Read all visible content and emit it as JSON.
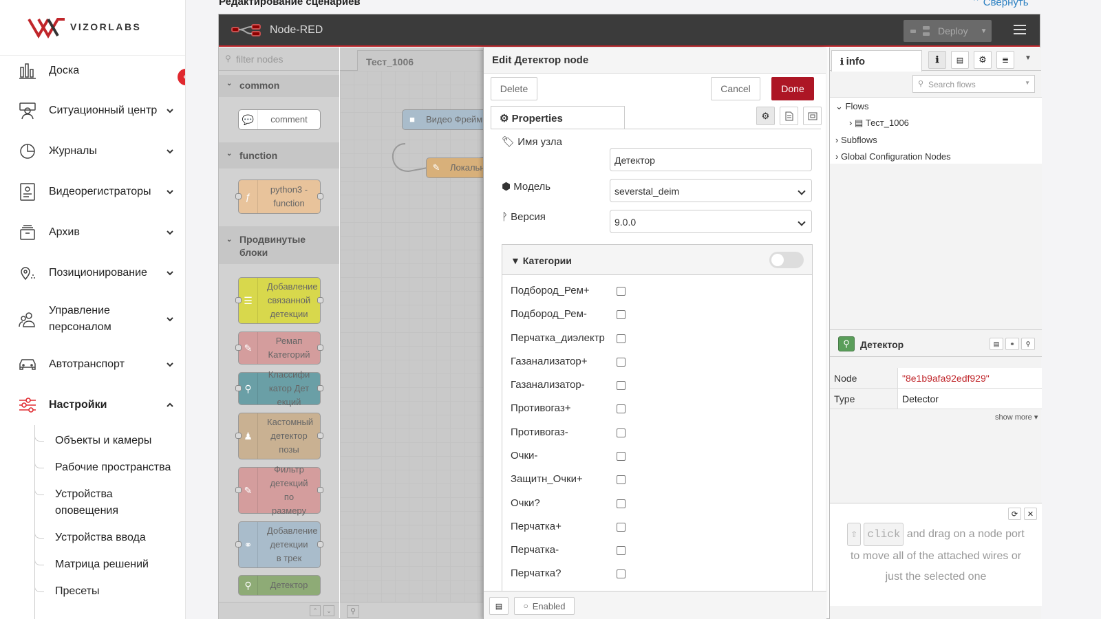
{
  "brand": {
    "name": "VIZORLABS"
  },
  "sidebar": {
    "items": [
      {
        "label": "Доска",
        "icon": "dashboard-icon"
      },
      {
        "label": "Ситуационный центр",
        "icon": "situation-center-icon"
      },
      {
        "label": "Журналы",
        "icon": "journal-chart-icon"
      },
      {
        "label": "Видеорегистраторы",
        "icon": "video-recorder-icon"
      },
      {
        "label": "Архив",
        "icon": "archive-icon"
      },
      {
        "label": "Позиционирование",
        "icon": "location-icon"
      },
      {
        "label": "Управление персоналом",
        "icon": "staff-icon"
      },
      {
        "label": "Автотранспорт",
        "icon": "car-icon"
      },
      {
        "label": "Настройки",
        "icon": "settings-sliders-icon"
      }
    ],
    "sub_items": [
      "Объекты и камеры",
      "Рабочие пространства",
      "Устройства оповещения",
      "Устройства ввода",
      "Матрица решений",
      "Пресеты"
    ],
    "accent": "#e0282e"
  },
  "page": {
    "title": "Редактирование сценариев",
    "collapse_label": "Свернуть"
  },
  "nodered": {
    "title": "Node-RED",
    "deploy_label": "Deploy",
    "palette": {
      "filter_placeholder": "filter nodes",
      "categories": [
        {
          "name": "common",
          "nodes": [
            "comment"
          ]
        },
        {
          "name": "function",
          "nodes": [
            "python3 - function"
          ]
        },
        {
          "name": "Продвинутые блоки",
          "nodes": [
            "Добавление связанной детекции",
            "Ремап Категорий",
            "Классификатор Детекций",
            "Кастомный детектор позы",
            "Фильтр детекций по размеру",
            "Добавление детекции в трек",
            "Детектор"
          ]
        }
      ]
    },
    "workspace": {
      "tab": "Тест_1006",
      "nodes": [
        "Видео Фрейм",
        "Локальн"
      ]
    },
    "editor": {
      "title": "Edit Детектор node",
      "delete_label": "Delete",
      "cancel_label": "Cancel",
      "done_label": "Done",
      "properties_tab": "Properties",
      "fields": [
        {
          "label": "Имя узла",
          "value": "Детектор",
          "type": "input"
        },
        {
          "label": "Модель",
          "value": "severstal_deim",
          "type": "select"
        },
        {
          "label": "Версия",
          "value": "9.0.0",
          "type": "select"
        }
      ],
      "categories_title": "Категории",
      "categories": [
        "Подбород_Рем+",
        "Подбород_Рем-",
        "Перчатка_диэлектр",
        "Газанализатор+",
        "Газанализатор-",
        "Противогаз+",
        "Противогаз-",
        "Очки-",
        "Защитн_Очки+",
        "Очки?",
        "Перчатка+",
        "Перчатка-",
        "Перчатка?"
      ],
      "enabled_label": "Enabled"
    },
    "sidebar": {
      "info_tab": "info",
      "search_placeholder": "Search flows",
      "tree": {
        "flows": "Flows",
        "flow_item": "Тест_1006",
        "subflows": "Subflows",
        "global": "Global Configuration Nodes"
      },
      "node_title": "Детектор",
      "node_props": [
        {
          "key": "Node",
          "value": "\"8e1b9afa92edf929\""
        },
        {
          "key": "Type",
          "value": "Detector"
        }
      ],
      "show_more": "show more ▾",
      "help": {
        "key": "click",
        "text1": "and drag on a node port",
        "text2": "to move all of the attached wires or",
        "text3": "just the selected one"
      }
    }
  }
}
